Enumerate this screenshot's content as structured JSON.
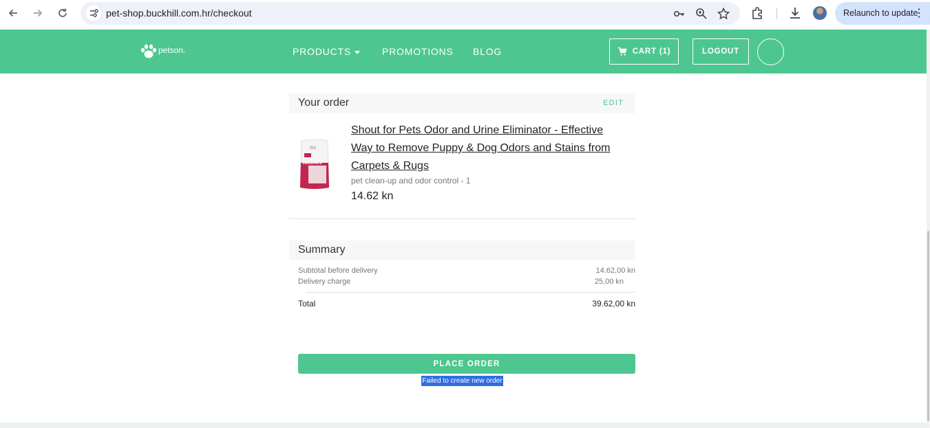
{
  "browser": {
    "url": "pet-shop.buckhill.com.hr/checkout",
    "relaunch_label": "Relaunch to update",
    "icons": [
      "back-icon",
      "forward-icon",
      "reload-icon",
      "site-info-icon",
      "key-icon",
      "zoom-icon",
      "star-icon",
      "extensions-icon",
      "download-icon",
      "profile-avatar",
      "more-icon"
    ]
  },
  "header": {
    "logo_text": "petson.",
    "nav": {
      "products": "PRODUCTS",
      "promotions": "PROMOTIONS",
      "blog": "BLOG"
    },
    "cart_label": "CART (1)",
    "logout_label": "LOGOUT"
  },
  "order": {
    "title": "Your order",
    "edit_label": "EDIT",
    "item": {
      "name": "Shout for Pets Odor and Urine Eliminator - Effective Way to Remove Puppy & Dog Odors and Stains from Carpets & Rugs",
      "category_qty": "pet clean-up and odor control - 1",
      "price": "14.62 kn",
      "image_brand": "Brit",
      "image_label": "ENDURANCE"
    }
  },
  "summary": {
    "title": "Summary",
    "rows": [
      {
        "label": "Subtotal before delivery",
        "value": "14.62,00 kn"
      },
      {
        "label": "Delivery charge",
        "value": "25,00 kn"
      }
    ],
    "total_label": "Total",
    "total_value": "39.62,00 kn"
  },
  "actions": {
    "place_order_label": "PLACE ORDER",
    "error_message": "Failed to create new order"
  },
  "colors": {
    "brand": "#4ec690",
    "error_bg": "#2f6de1",
    "relaunch_bg": "#d3e3fd"
  }
}
